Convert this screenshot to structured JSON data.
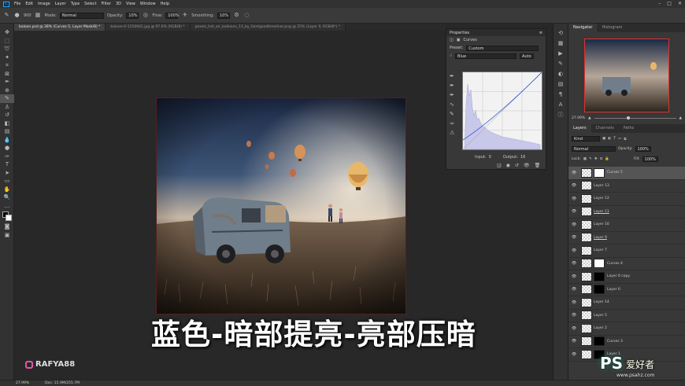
{
  "menubar": {
    "app_badge": "Ps",
    "items": [
      "File",
      "Edit",
      "Image",
      "Layer",
      "Type",
      "Select",
      "Filter",
      "3D",
      "View",
      "Window",
      "Help"
    ]
  },
  "options": {
    "brush_size": "900",
    "mode_label": "Mode:",
    "mode_value": "Normal",
    "opacity_label": "Opacity:",
    "opacity_value": "10%",
    "flow_label": "Flow:",
    "flow_value": "100%",
    "smoothing_label": "Smoothing:",
    "smoothing_value": "10%"
  },
  "tabs": [
    {
      "label": "baloon.psd @ 28% (Curves 5, Layer Mask/8) *",
      "active": true
    },
    {
      "label": "baloon-0-1550941.jpg @ 97.6% (RGB/8) *"
    },
    {
      "label": "pexels_hot_air_balloons_13_by_faintgoodtimeliner.png @ 25% (Layer 0, RGB/8*) *"
    }
  ],
  "caption": "蓝色-暗部提亮-亮部压暗",
  "watermark": "RAFYA88",
  "status": {
    "zoom": "27.99%",
    "doc": "Doc: 15.9M/255.7M"
  },
  "properties": {
    "title": "Properties",
    "adjustment": "Curves",
    "preset_label": "Preset:",
    "preset_value": "Custom",
    "channel_value": "Blue",
    "auto_label": "Auto",
    "input_label": "Input:",
    "input_value": "0",
    "output_label": "Output:",
    "output_value": "16"
  },
  "navigator": {
    "tab1": "Navigator",
    "tab2": "Histogram",
    "zoom": "27.99%"
  },
  "layers_panel": {
    "tab1": "Layers",
    "tab2": "Channels",
    "tab3": "Paths",
    "kind_label": "Kind",
    "blend_mode": "Normal",
    "opacity_label": "Opacity:",
    "opacity_value": "100%",
    "lock_label": "Lock:",
    "fill_label": "Fill:",
    "fill_value": "100%",
    "layers": [
      {
        "name": "Curves 5",
        "mask": "white",
        "selected": true
      },
      {
        "name": "Layer 13"
      },
      {
        "name": "Layer 12"
      },
      {
        "name": "Layer 11",
        "underline": true
      },
      {
        "name": "Layer 10"
      },
      {
        "name": "Layer 9",
        "underline": true
      },
      {
        "name": "Layer 7"
      },
      {
        "name": "Curves 4",
        "mask": "white"
      },
      {
        "name": "Layer 6 copy",
        "mask": "black"
      },
      {
        "name": "Layer 6",
        "mask": "black"
      },
      {
        "name": "Layer 14"
      },
      {
        "name": "Layer 5"
      },
      {
        "name": "Layer 2"
      },
      {
        "name": "Curves 3",
        "mask": "black"
      },
      {
        "name": "Layer 1",
        "mask": "black"
      }
    ]
  },
  "site_logo": {
    "ps": "PS",
    "name": "爱好者",
    "url": "www.psahz.com"
  }
}
